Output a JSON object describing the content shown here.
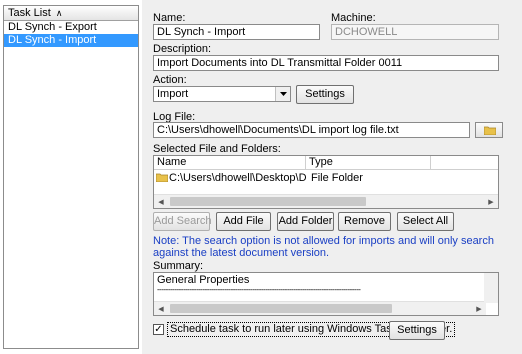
{
  "task_list": {
    "header": "Task List",
    "sort_icon": "sort-ascending-icon",
    "items": [
      {
        "label": "DL Synch - Export",
        "selected": false
      },
      {
        "label": "DL Synch - Import",
        "selected": true
      }
    ]
  },
  "form": {
    "name_label": "Name:",
    "name_value": "DL Synch - Import",
    "machine_label": "Machine:",
    "machine_value": "DCHOWELL",
    "description_label": "Description:",
    "description_value": "Import Documents into DL Transmittal Folder 0011",
    "action_label": "Action:",
    "action_value": "Import",
    "action_settings_label": "Settings",
    "log_file_label": "Log File:",
    "log_file_value": "C:\\Users\\dhowell\\Documents\\DL import log file.txt",
    "selected_label": "Selected File and Folders:",
    "columns": [
      "Name",
      "Type"
    ],
    "rows": [
      {
        "name": "C:\\Users\\dhowell\\Desktop\\DL-Synch",
        "type": "File Folder"
      }
    ],
    "buttons": {
      "add_search": "Add Search",
      "add_file": "Add File",
      "add_folder": "Add Folder",
      "remove": "Remove",
      "select_all": "Select All"
    },
    "note": "Note: The search option is not allowed for imports and will only search against the latest document version.",
    "summary_label": "Summary:",
    "summary_lines": [
      "General Properties",
      "----------------------------------------------------------------------------------------------"
    ],
    "schedule_checked": true,
    "schedule_label": "Schedule task to run later using Windows Task Scheduler.",
    "schedule_settings_label": "Settings"
  },
  "colors": {
    "selection": "#3399ff",
    "note_text": "#1a3fc4",
    "panel_bg": "#efefef"
  }
}
